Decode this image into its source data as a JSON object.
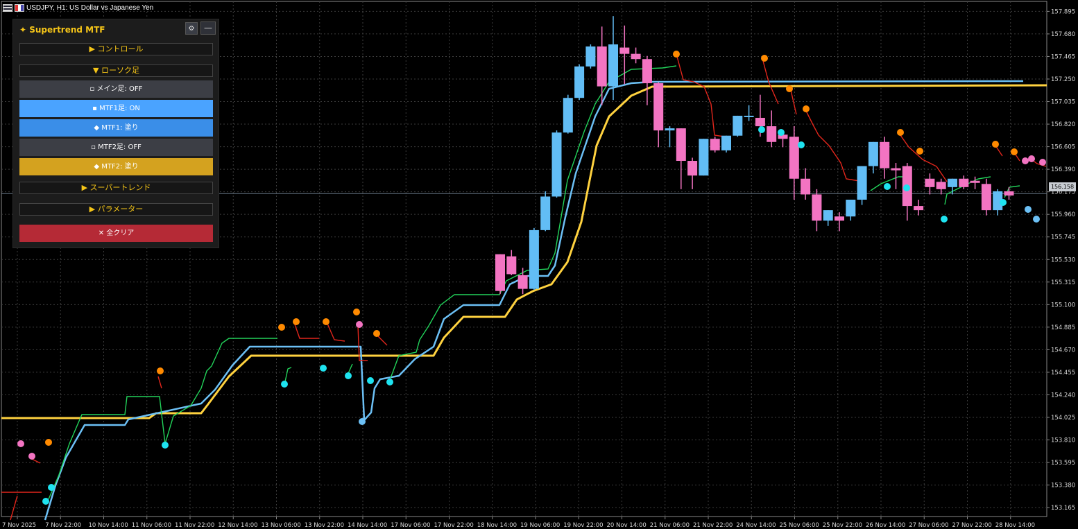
{
  "window": {
    "title": "USDJPY, H1:  US Dollar vs Japanese Yen"
  },
  "panel": {
    "title": "✦ Supertrend MTF",
    "gear_icon": "⚙",
    "minimize_label": "—",
    "sections": {
      "control": "▶ コントロール",
      "candle": "▼ ローソク足",
      "supertrend": "▶ スーパートレンド",
      "parameters": "▶ パラメーター"
    },
    "buttons": {
      "main_candle": "▫ メイン足: OFF",
      "mtf1_candle": "▪ MTF1足: ON",
      "mtf1_fill": "◆ MTF1: 塗り",
      "mtf2_candle": "▫ MTF2足: OFF",
      "mtf2_fill": "◆ MTF2: 塗り",
      "clear_all": "✕ 全クリア"
    },
    "colors": {
      "off": "#3c3e45",
      "mtf1_on": "#4aa3ff",
      "mtf1_fill": "#3a8ee8",
      "mtf2_fill": "#d4a21f",
      "clear": "#b52a36"
    }
  },
  "current_price": "156.158",
  "chart_data": {
    "type": "candlestick",
    "symbol": "USDJPY",
    "timeframe": "H1",
    "price_ticks": [
      "157.895",
      "157.680",
      "157.465",
      "157.250",
      "157.035",
      "156.820",
      "156.605",
      "156.390",
      "156.175",
      "155.960",
      "155.745",
      "155.530",
      "155.315",
      "155.100",
      "154.885",
      "154.670",
      "154.455",
      "154.240",
      "154.025",
      "153.810",
      "153.595",
      "153.380",
      "153.165"
    ],
    "time_ticks": [
      "7 Nov 2025",
      "7 Nov 22:00",
      "10 Nov 14:00",
      "11 Nov 06:00",
      "11 Nov 22:00",
      "12 Nov 14:00",
      "13 Nov 06:00",
      "13 Nov 22:00",
      "14 Nov 14:00",
      "17 Nov 06:00",
      "17 Nov 22:00",
      "18 Nov 14:00",
      "19 Nov 06:00",
      "19 Nov 22:00",
      "20 Nov 14:00",
      "21 Nov 06:00",
      "21 Nov 22:00",
      "24 Nov 14:00",
      "25 Nov 06:00",
      "25 Nov 22:00",
      "26 Nov 14:00",
      "27 Nov 06:00",
      "27 Nov 22:00",
      "28 Nov 14:00"
    ],
    "ylim": [
      153.08,
      157.99
    ],
    "colors": {
      "bull": "#62bdf5",
      "bear": "#f374c2",
      "st_up": "#22d35a",
      "st_down": "#e2261c",
      "mtf1": "#6cc0f5",
      "mtf2": "#ffd23f",
      "dot_up": "#1ee3f0",
      "dot_down": "#ff8a00",
      "dot_pink": "#f374c2"
    },
    "candles_mtf1": [
      {
        "t": "18 Nov 13:00",
        "o": 155.58,
        "h": 155.58,
        "c": 155.23,
        "l": 155.2
      },
      {
        "t": "18 Nov 15:00",
        "o": 155.56,
        "h": 155.62,
        "c": 155.39,
        "l": 155.38
      },
      {
        "t": "18 Nov 19:00",
        "o": 155.38,
        "h": 155.45,
        "c": 155.25,
        "l": 155.2
      },
      {
        "t": "18 Nov 23:00",
        "o": 155.25,
        "h": 155.83,
        "c": 155.81,
        "l": 155.24
      },
      {
        "t": "19 Nov 03:00",
        "o": 155.81,
        "h": 156.18,
        "c": 156.13,
        "l": 155.8
      },
      {
        "t": "19 Nov 07:00",
        "o": 156.13,
        "h": 156.76,
        "c": 156.74,
        "l": 156.12
      },
      {
        "t": "19 Nov 11:00",
        "o": 156.74,
        "h": 157.1,
        "c": 157.07,
        "l": 156.73
      },
      {
        "t": "19 Nov 15:00",
        "o": 157.07,
        "h": 157.39,
        "c": 157.37,
        "l": 157.05
      },
      {
        "t": "19 Nov 19:00",
        "o": 157.37,
        "h": 157.58,
        "c": 157.56,
        "l": 157.35
      },
      {
        "t": "19 Nov 23:00",
        "o": 157.56,
        "h": 157.75,
        "c": 157.18,
        "l": 157.0
      },
      {
        "t": "20 Nov 03:00",
        "o": 157.18,
        "h": 157.85,
        "c": 157.58,
        "l": 157.05
      },
      {
        "t": "20 Nov 07:00",
        "o": 157.55,
        "h": 157.76,
        "c": 157.49,
        "l": 157.2
      },
      {
        "t": "20 Nov 11:00",
        "o": 157.49,
        "h": 157.55,
        "c": 157.44,
        "l": 157.4
      },
      {
        "t": "20 Nov 15:00",
        "o": 157.44,
        "h": 157.47,
        "c": 157.21,
        "l": 157.0
      },
      {
        "t": "20 Nov 19:00",
        "o": 157.21,
        "h": 157.22,
        "c": 156.76,
        "l": 156.6
      },
      {
        "t": "20 Nov 23:00",
        "o": 156.76,
        "h": 156.8,
        "c": 156.78,
        "l": 156.6
      },
      {
        "t": "21 Nov 03:00",
        "o": 156.78,
        "h": 156.78,
        "c": 156.47,
        "l": 156.2
      },
      {
        "t": "21 Nov 07:00",
        "o": 156.47,
        "h": 156.5,
        "c": 156.33,
        "l": 156.2
      },
      {
        "t": "21 Nov 11:00",
        "o": 156.33,
        "h": 156.68,
        "c": 156.68,
        "l": 156.33
      },
      {
        "t": "21 Nov 15:00",
        "o": 156.68,
        "h": 156.7,
        "c": 156.57,
        "l": 156.55
      },
      {
        "t": "21 Nov 19:00",
        "o": 156.57,
        "h": 156.71,
        "c": 156.71,
        "l": 156.55
      },
      {
        "t": "24 Nov 03:00",
        "o": 156.71,
        "h": 156.9,
        "c": 156.9,
        "l": 156.7
      },
      {
        "t": "24 Nov 07:00",
        "o": 156.9,
        "h": 157.0,
        "c": 156.9,
        "l": 156.85
      },
      {
        "t": "24 Nov 11:00",
        "o": 156.88,
        "h": 157.1,
        "c": 156.8,
        "l": 156.7
      },
      {
        "t": "24 Nov 15:00",
        "o": 156.8,
        "h": 156.95,
        "c": 156.65,
        "l": 156.6
      },
      {
        "t": "24 Nov 19:00",
        "o": 156.72,
        "h": 156.76,
        "c": 156.68,
        "l": 156.6
      },
      {
        "t": "25 Nov 03:00",
        "o": 156.7,
        "h": 156.8,
        "c": 156.3,
        "l": 156.1
      },
      {
        "t": "25 Nov 07:00",
        "o": 156.3,
        "h": 156.4,
        "c": 156.15,
        "l": 156.1
      },
      {
        "t": "25 Nov 11:00",
        "o": 156.15,
        "h": 156.2,
        "c": 155.9,
        "l": 155.8
      },
      {
        "t": "25 Nov 15:00",
        "o": 155.9,
        "h": 156.0,
        "c": 156.0,
        "l": 155.85
      },
      {
        "t": "25 Nov 19:00",
        "o": 155.94,
        "h": 155.98,
        "c": 155.9,
        "l": 155.8
      },
      {
        "t": "25 Nov 23:00",
        "o": 155.94,
        "h": 156.1,
        "c": 156.1,
        "l": 155.9
      },
      {
        "t": "26 Nov 03:00",
        "o": 156.1,
        "h": 156.42,
        "c": 156.42,
        "l": 156.05
      },
      {
        "t": "26 Nov 07:00",
        "o": 156.42,
        "h": 156.65,
        "c": 156.65,
        "l": 156.35
      },
      {
        "t": "26 Nov 11:00",
        "o": 156.65,
        "h": 156.7,
        "c": 156.4,
        "l": 156.3
      },
      {
        "t": "26 Nov 15:00",
        "o": 156.4,
        "h": 156.45,
        "c": 156.38,
        "l": 156.2
      },
      {
        "t": "26 Nov 19:00",
        "o": 156.42,
        "h": 156.45,
        "c": 156.04,
        "l": 155.9
      },
      {
        "t": "26 Nov 23:00",
        "o": 156.04,
        "h": 156.1,
        "c": 156.0,
        "l": 155.95
      },
      {
        "t": "27 Nov 03:00",
        "o": 156.3,
        "h": 156.35,
        "c": 156.22,
        "l": 156.15
      },
      {
        "t": "27 Nov 07:00",
        "o": 156.27,
        "h": 156.3,
        "c": 156.2,
        "l": 156.15
      },
      {
        "t": "27 Nov 11:00",
        "o": 156.22,
        "h": 156.3,
        "c": 156.3,
        "l": 156.15
      },
      {
        "t": "27 Nov 15:00",
        "o": 156.3,
        "h": 156.33,
        "c": 156.22,
        "l": 156.2
      },
      {
        "t": "27 Nov 19:00",
        "o": 156.28,
        "h": 156.32,
        "c": 156.26,
        "l": 156.2
      },
      {
        "t": "27 Nov 23:00",
        "o": 156.25,
        "h": 156.3,
        "c": 156.0,
        "l": 155.95
      },
      {
        "t": "28 Nov 03:00",
        "o": 156.0,
        "h": 156.2,
        "c": 156.18,
        "l": 155.95
      },
      {
        "t": "28 Nov 07:00",
        "o": 156.18,
        "h": 156.22,
        "c": 156.14,
        "l": 156.1
      }
    ]
  }
}
